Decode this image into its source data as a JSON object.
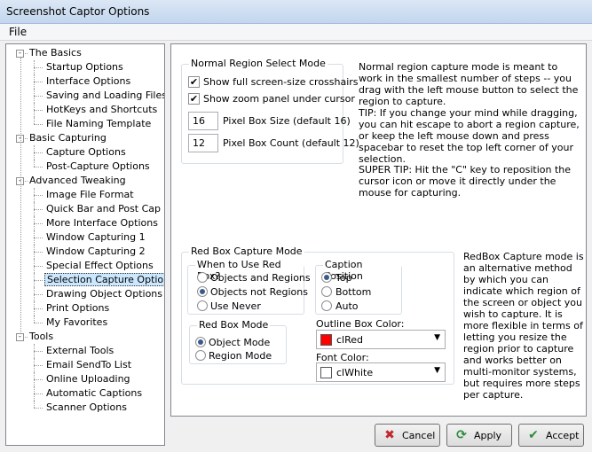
{
  "window": {
    "title": "Screenshot Captor Options"
  },
  "menu": {
    "file": "File"
  },
  "tree": [
    {
      "label": "The Basics",
      "level": 0,
      "expander": "-"
    },
    {
      "label": "Startup Options",
      "level": 1
    },
    {
      "label": "Interface Options",
      "level": 1
    },
    {
      "label": "Saving and Loading Files",
      "level": 1
    },
    {
      "label": "HotKeys and Shortcuts",
      "level": 1
    },
    {
      "label": "File Naming Template",
      "level": 1
    },
    {
      "label": "Basic Capturing",
      "level": 0,
      "expander": "-"
    },
    {
      "label": "Capture Options",
      "level": 1
    },
    {
      "label": "Post-Capture Options",
      "level": 1
    },
    {
      "label": "Advanced Tweaking",
      "level": 0,
      "expander": "-"
    },
    {
      "label": "Image File Format",
      "level": 1
    },
    {
      "label": "Quick Bar and Post Cap",
      "level": 1
    },
    {
      "label": "More Interface Options",
      "level": 1
    },
    {
      "label": "Window Capturing 1",
      "level": 1
    },
    {
      "label": "Window Capturing 2",
      "level": 1
    },
    {
      "label": "Special Effect Options",
      "level": 1
    },
    {
      "label": "Selection Capture Options",
      "level": 1,
      "selected": true
    },
    {
      "label": "Drawing Object Options",
      "level": 1
    },
    {
      "label": "Print Options",
      "level": 1
    },
    {
      "label": "My Favorites",
      "level": 1
    },
    {
      "label": "Tools",
      "level": 0,
      "expander": "-"
    },
    {
      "label": "External Tools",
      "level": 1
    },
    {
      "label": "Email SendTo List",
      "level": 1
    },
    {
      "label": "Online Uploading",
      "level": 1
    },
    {
      "label": "Automatic Captions",
      "level": 1
    },
    {
      "label": "Scanner Options",
      "level": 1
    }
  ],
  "normal": {
    "title": "Normal Region Select Mode",
    "crosshairs": {
      "label": "Show full screen-size crosshairs",
      "checked": true
    },
    "zoom": {
      "label": "Show zoom panel under cursor",
      "checked": true
    },
    "pixel_size": {
      "value": "16",
      "label": "Pixel Box Size (default 16)"
    },
    "pixel_count": {
      "value": "12",
      "label": "Pixel Box Count (default 12)"
    },
    "desc1": "Normal region capture mode is meant to work in the smallest number of steps -- you drag with the left mouse button to select the region to capture.",
    "desc2": "TIP: If you change your mind while dragging, you can hit escape to abort a region capture, or keep the left mouse down and press spacebar to reset the top left corner of your selection.",
    "desc3": "SUPER TIP: Hit the \"C\" key to reposition the cursor icon or move it directly under the mouse for capturing."
  },
  "redbox": {
    "title": "Red Box Capture Mode",
    "when_title": "When to Use Red Box?",
    "when_options": [
      "Objects and Regions",
      "Objects not Regions",
      "Use Never"
    ],
    "when_selected": 1,
    "caption_title": "Caption Position",
    "caption_options": [
      "Top",
      "Bottom",
      "Auto"
    ],
    "caption_selected": 0,
    "mode_title": "Red Box Mode",
    "mode_options": [
      "Object Mode",
      "Region Mode"
    ],
    "mode_selected": 0,
    "outline_label": "Outline Box Color:",
    "outline_value": "clRed",
    "outline_color": "#ff0000",
    "font_label": "Font Color:",
    "font_value": "clWhite",
    "font_color": "#ffffff",
    "desc": "RedBox Capture mode is an alternative method by which you can indicate which region of the screen or object you wish to capture. It is more flexible in terms of letting you resize the region prior to capture and works better on multi-monitor systems, but requires more steps per capture."
  },
  "buttons": {
    "cancel": {
      "label": "Cancel",
      "icon": "x-icon"
    },
    "apply": {
      "label": "Apply",
      "icon": "refresh-icon"
    },
    "accept": {
      "label": "Accept",
      "icon": "checkmark-icon"
    }
  }
}
